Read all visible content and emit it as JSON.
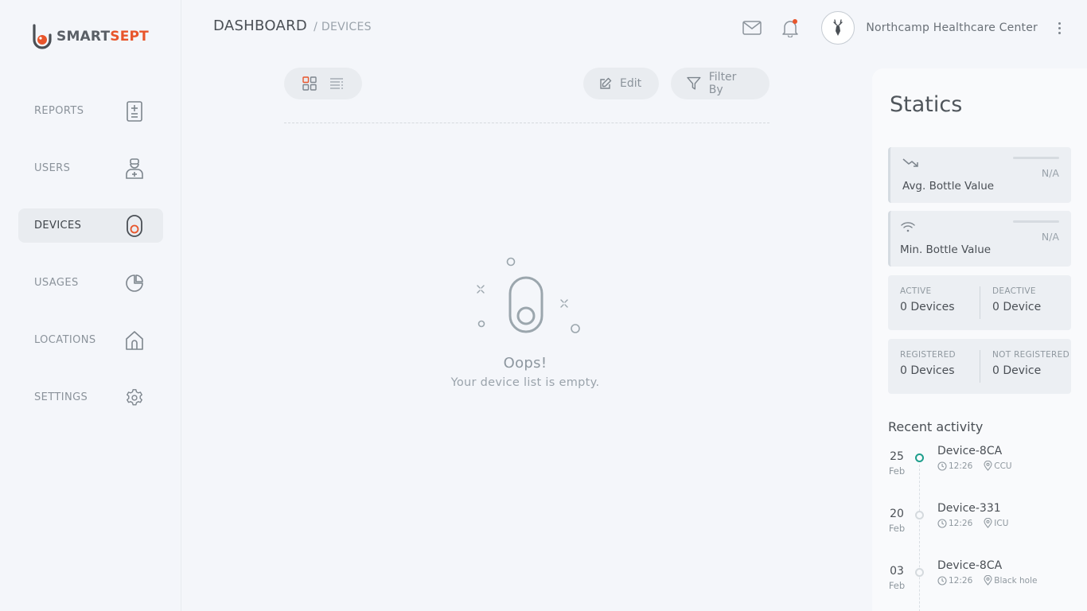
{
  "brand": {
    "part1": "SMART",
    "part2": "SEPT",
    "accent": "#e8552b"
  },
  "sidebar": {
    "items": [
      {
        "label": "REPORTS",
        "icon": "report-icon",
        "active": false
      },
      {
        "label": "USERS",
        "icon": "user-medical-icon",
        "active": false
      },
      {
        "label": "DEVICES",
        "icon": "device-icon",
        "active": true
      },
      {
        "label": "USAGES",
        "icon": "pie-chart-icon",
        "active": false
      },
      {
        "label": "LOCATIONS",
        "icon": "home-icon",
        "active": false
      },
      {
        "label": "SETTINGS",
        "icon": "gear-icon",
        "active": false
      }
    ]
  },
  "header": {
    "breadcrumb_main": "DASHBOARD",
    "breadcrumb_sub": "/ DEVICES",
    "org_name": "Northcamp Healthcare Center",
    "notification_dot": true
  },
  "toolbar": {
    "edit_label": "Edit",
    "filter_label": "Filter By",
    "active_view": "grid"
  },
  "empty_state": {
    "title": "Oops!",
    "message": "Your device list is empty."
  },
  "statics": {
    "title": "Statics",
    "avg_label": "Avg. Bottle Value",
    "avg_value": "N/A",
    "min_label": "Min. Bottle Value",
    "min_value": "N/A",
    "active_caption": "ACTIVE",
    "active_value": "0 Devices",
    "deactive_caption": "DEACTIVE",
    "deactive_value": "0 Device",
    "registered_caption": "REGISTERED",
    "registered_value": "0 Devices",
    "not_registered_caption": "NOT REGISTERED",
    "not_registered_value": "0 Device"
  },
  "recent": {
    "title": "Recent activity",
    "items": [
      {
        "day": "25",
        "month": "Feb",
        "device": "Device-8CA",
        "time": "12:26",
        "location": "CCU",
        "highlight": true
      },
      {
        "day": "20",
        "month": "Feb",
        "device": "Device-331",
        "time": "12:26",
        "location": "ICU",
        "highlight": false
      },
      {
        "day": "03",
        "month": "Feb",
        "device": "Device-8CA",
        "time": "12:26",
        "location": "Black hole",
        "highlight": false
      }
    ]
  }
}
